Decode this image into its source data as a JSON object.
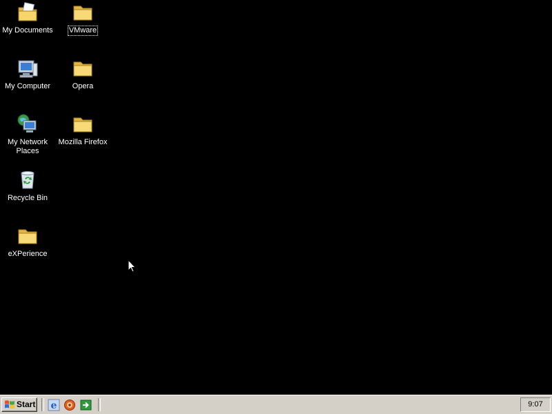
{
  "desktop": {
    "icons": [
      {
        "label": "My Documents",
        "icon": "my-documents-icon"
      },
      {
        "label": "VMware",
        "icon": "folder-icon"
      },
      {
        "label": "My Computer",
        "icon": "my-computer-icon"
      },
      {
        "label": "Opera",
        "icon": "folder-icon"
      },
      {
        "label": "My Network Places",
        "icon": "network-places-icon"
      },
      {
        "label": "Mozilla Firefox",
        "icon": "folder-icon"
      },
      {
        "label": "Recycle Bin",
        "icon": "recycle-bin-icon"
      },
      {
        "label": "eXPerience",
        "icon": "folder-icon"
      }
    ],
    "background_color": "#000000"
  },
  "taskbar": {
    "start_label": "Start",
    "quick_launch": [
      "internet-explorer-icon",
      "media-icon",
      "show-desktop-icon"
    ],
    "clock": "9:07",
    "background_color": "#d4d0c8"
  }
}
